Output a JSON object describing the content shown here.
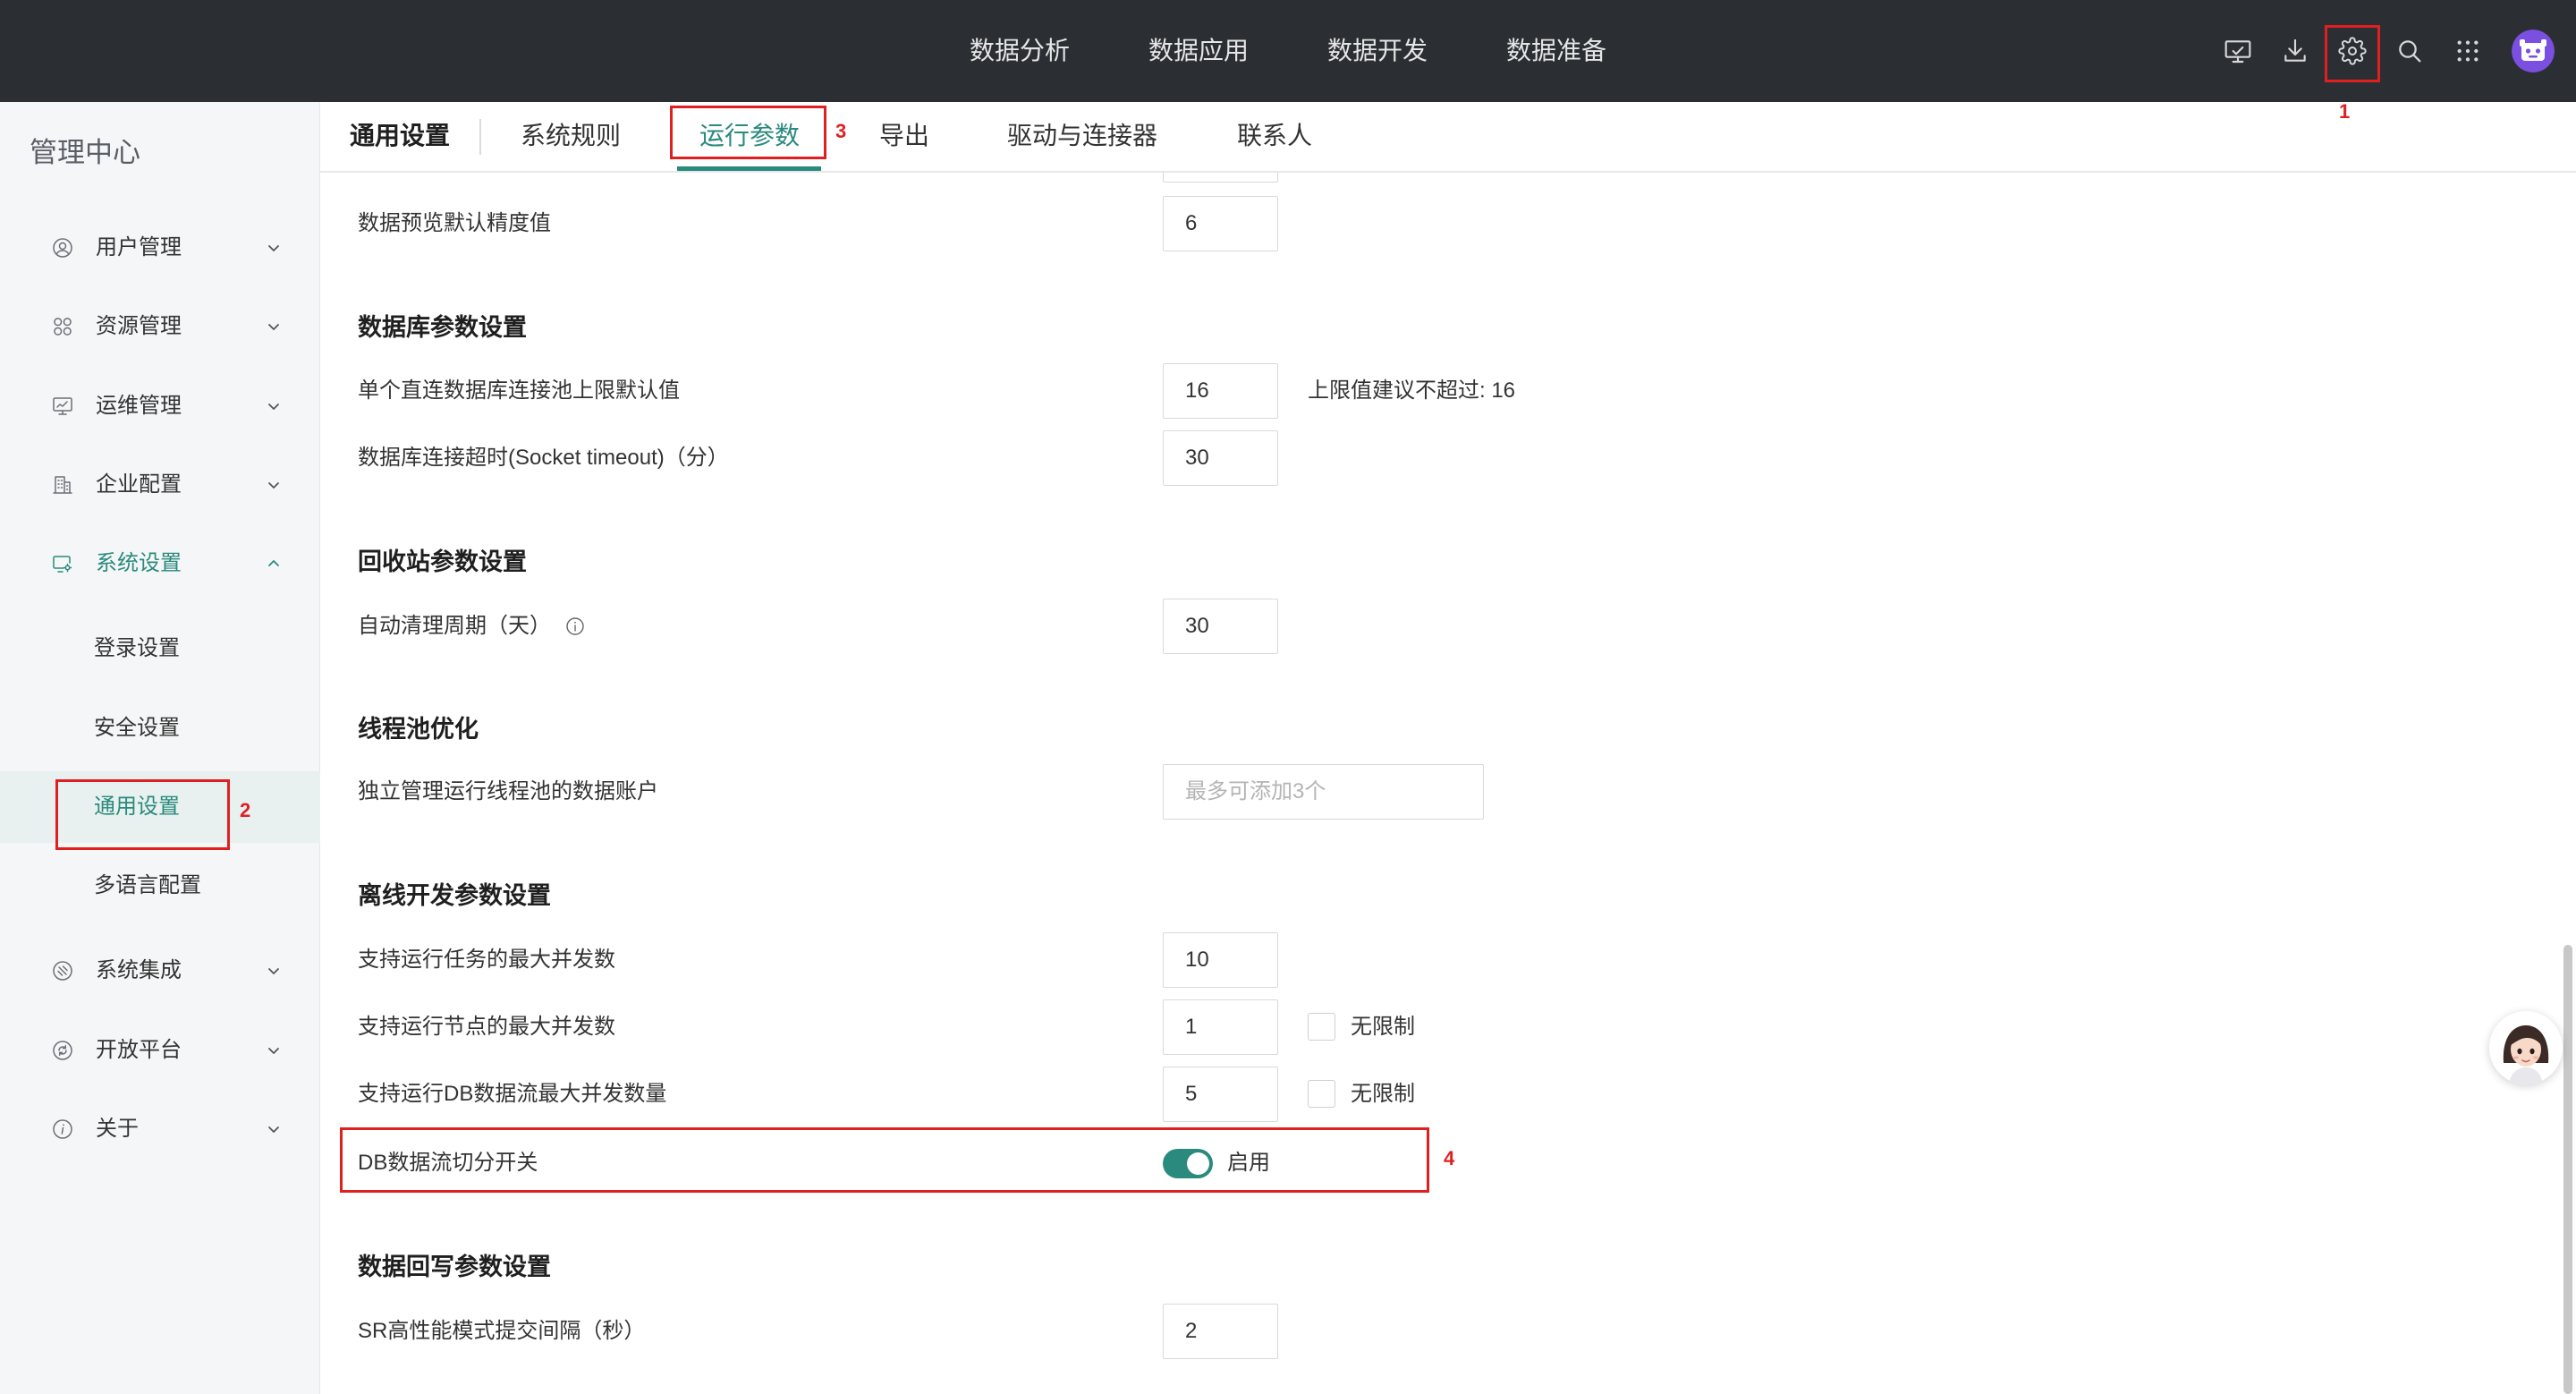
{
  "theme": {
    "accent": "#2a8a7d",
    "header_bg": "#2b2f33",
    "annotation": "#e02020",
    "sidebar_bg": "#f5f6f7"
  },
  "header": {
    "nav": [
      "数据分析",
      "数据应用",
      "数据开发",
      "数据准备"
    ],
    "icons": [
      "screen-share-icon",
      "download-icon",
      "gear-icon",
      "search-icon",
      "apps-grid-icon",
      "user-avatar"
    ]
  },
  "annotations": [
    "1",
    "2",
    "3",
    "4"
  ],
  "sidebar": {
    "title": "管理中心",
    "items": [
      {
        "label": "用户管理",
        "icon": "user-circle-icon",
        "expanded": false
      },
      {
        "label": "资源管理",
        "icon": "resource-grid-icon",
        "expanded": false
      },
      {
        "label": "运维管理",
        "icon": "monitor-chart-icon",
        "expanded": false
      },
      {
        "label": "企业配置",
        "icon": "building-icon",
        "expanded": false
      },
      {
        "label": "系统设置",
        "icon": "settings-monitor-icon",
        "expanded": true,
        "active": true,
        "children": [
          {
            "label": "登录设置"
          },
          {
            "label": "安全设置"
          },
          {
            "label": "通用设置",
            "active": true
          },
          {
            "label": "多语言配置"
          }
        ]
      },
      {
        "label": "系统集成",
        "icon": "integration-icon",
        "expanded": false
      },
      {
        "label": "开放平台",
        "icon": "open-platform-icon",
        "expanded": false
      },
      {
        "label": "关于",
        "icon": "info-icon",
        "expanded": false
      }
    ]
  },
  "tab_bar": {
    "title": "通用设置",
    "tabs": [
      {
        "label": "系统规则",
        "active": false
      },
      {
        "label": "运行参数",
        "active": true
      },
      {
        "label": "导出",
        "active": false
      },
      {
        "label": "驱动与连接器",
        "active": false
      },
      {
        "label": "联系人",
        "active": false
      }
    ]
  },
  "content": {
    "preview_precision": {
      "label": "数据预览默认精度值",
      "value": "6"
    },
    "sections": [
      {
        "title": "数据库参数设置",
        "rows": [
          {
            "label": "单个直连数据库连接池上限默认值",
            "value": "16",
            "hint": "上限值建议不超过: 16"
          },
          {
            "label": "数据库连接超时(Socket timeout)（分）",
            "value": "30"
          }
        ]
      },
      {
        "title": "回收站参数设置",
        "rows": [
          {
            "label": "自动清理周期（天）",
            "value": "30",
            "icon": "info-circle-icon"
          }
        ]
      },
      {
        "title": "线程池优化",
        "rows": [
          {
            "label": "独立管理运行线程池的数据账户",
            "placeholder": "最多可添加3个"
          }
        ]
      },
      {
        "title": "离线开发参数设置",
        "rows": [
          {
            "label": "支持运行任务的最大并发数",
            "value": "10"
          },
          {
            "label": "支持运行节点的最大并发数",
            "value": "1",
            "checkbox_label": "无限制",
            "checked": false
          },
          {
            "label": "支持运行DB数据流最大并发数量",
            "value": "5",
            "checkbox_label": "无限制",
            "checked": false
          },
          {
            "label": "DB数据流切分开关",
            "toggle_on": true,
            "toggle_label": "启用"
          }
        ]
      },
      {
        "title": "数据回写参数设置",
        "rows": [
          {
            "label": "SR高性能模式提交间隔（秒）",
            "value": "2"
          }
        ]
      }
    ]
  },
  "floating_assistant": {
    "icon": "assistant-avatar-icon"
  }
}
